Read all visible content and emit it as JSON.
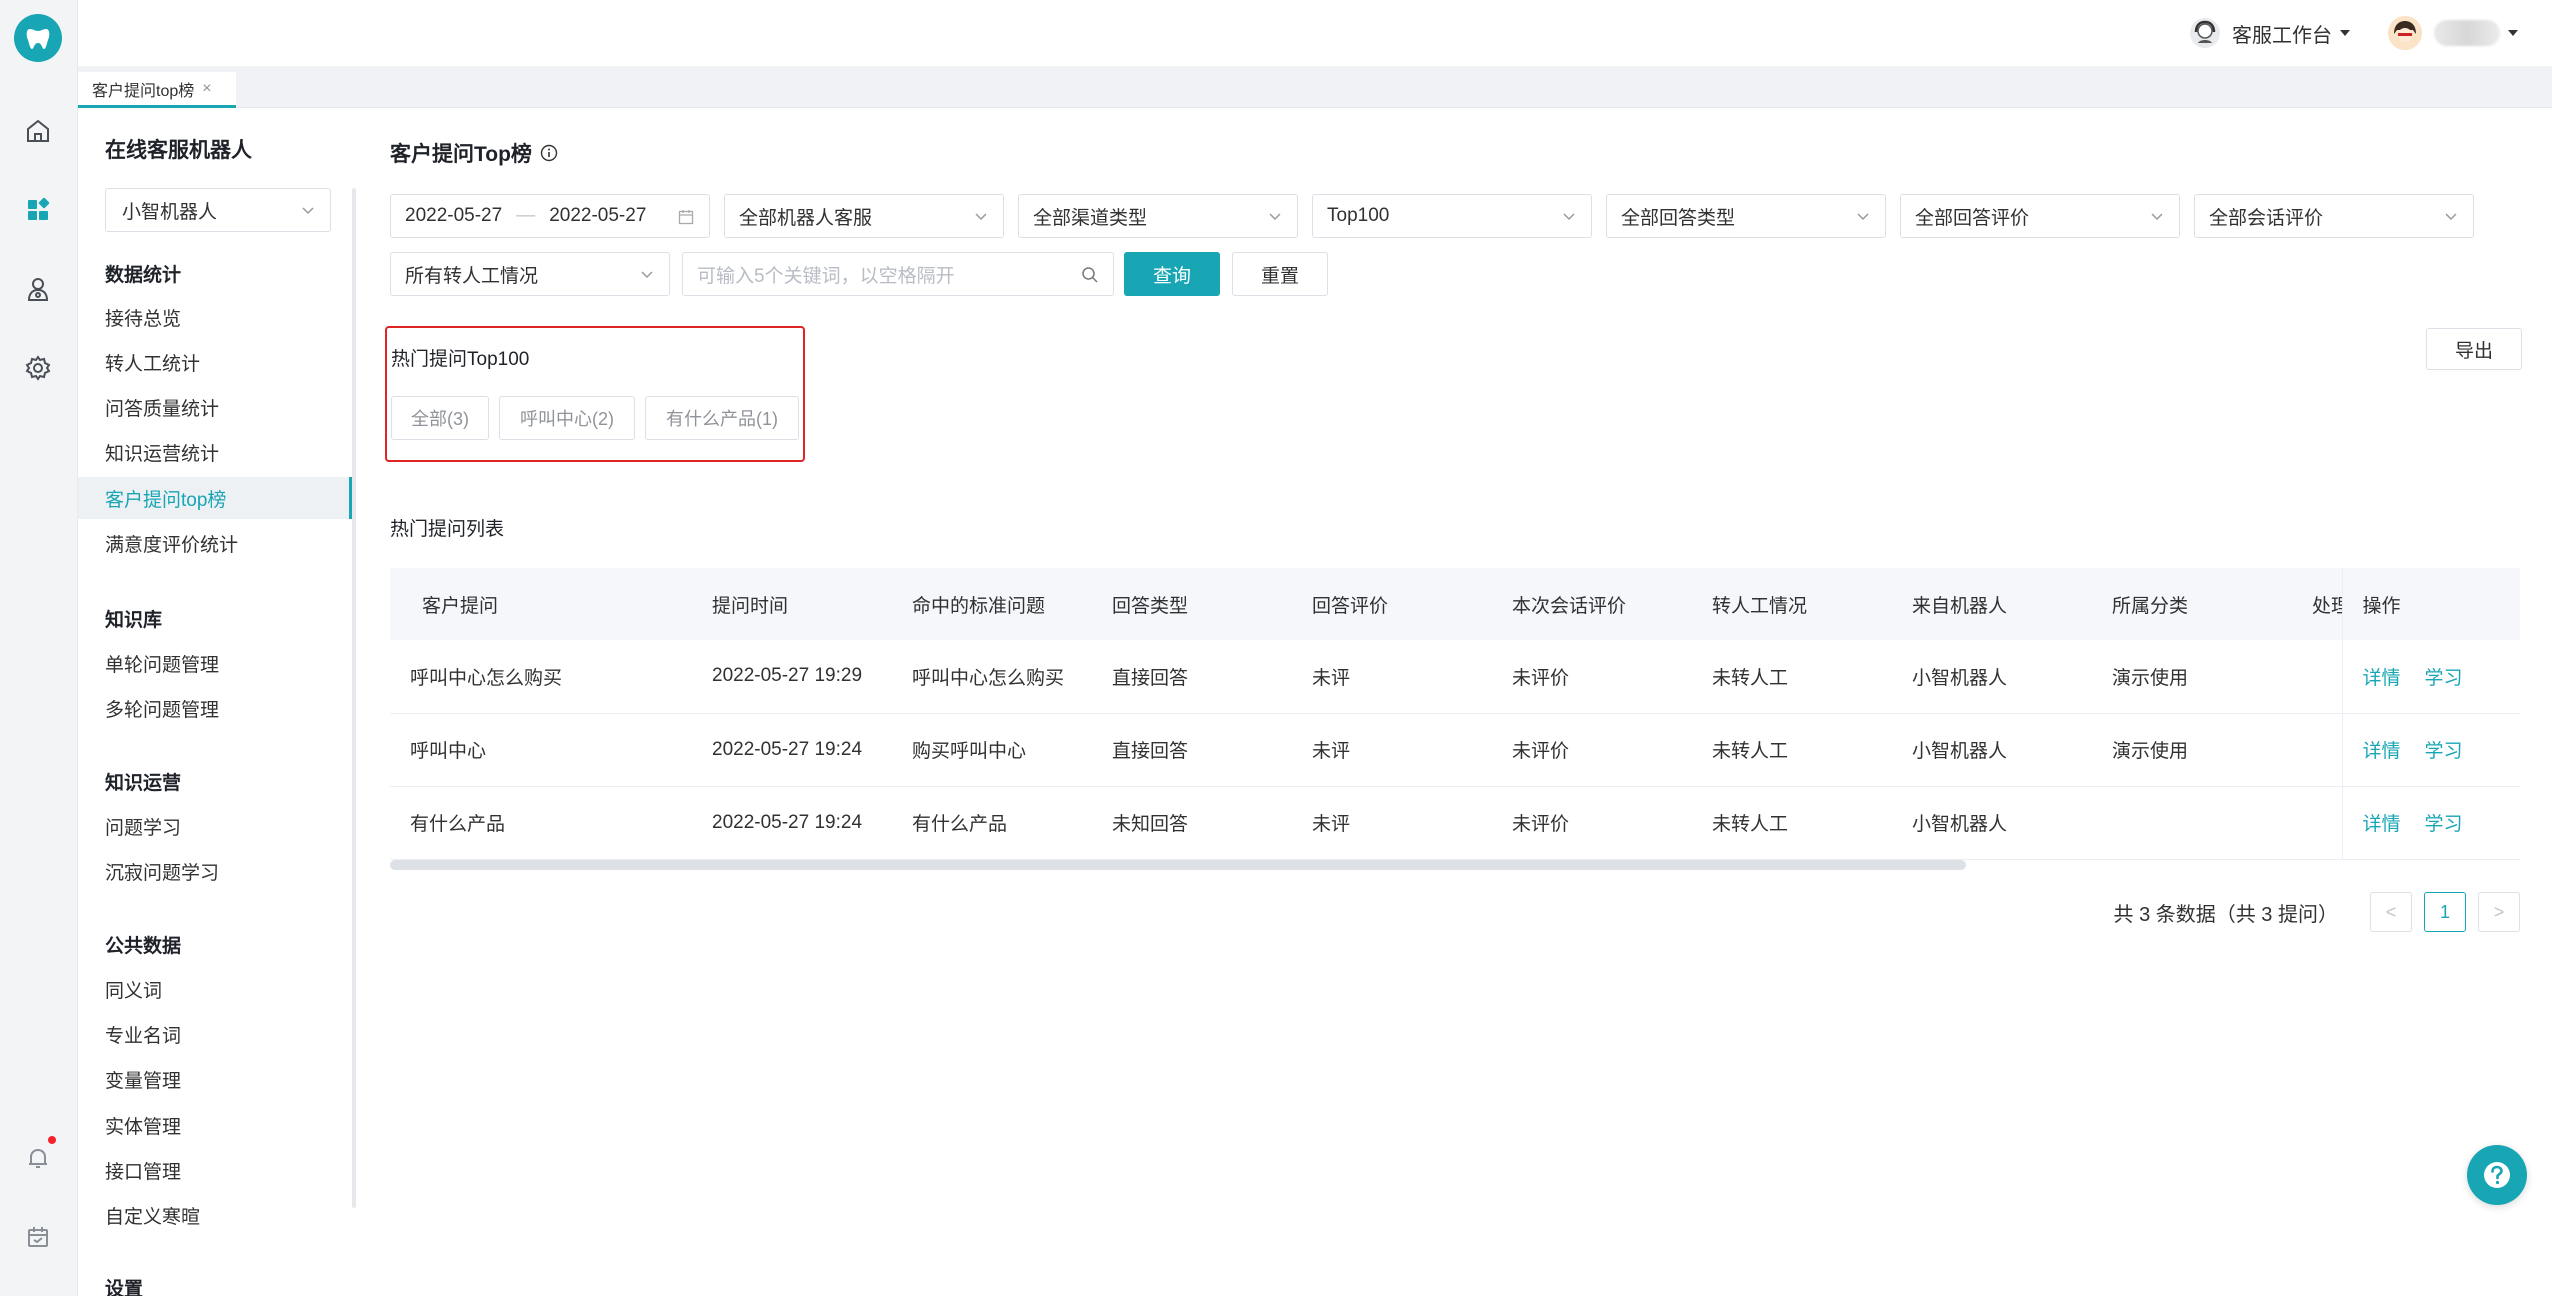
{
  "header": {
    "workbench_label": "客服工作台",
    "accent_color": "#18a5b4"
  },
  "tabs": [
    {
      "label": "客户提问top榜",
      "close": "×"
    }
  ],
  "sidebar": {
    "title": "在线客服机器人",
    "robot_select": "小智机器人",
    "groups": [
      {
        "label": "数据统计",
        "items": [
          "接待总览",
          "转人工统计",
          "问答质量统计",
          "知识运营统计",
          "客户提问top榜",
          "满意度评价统计"
        ]
      },
      {
        "label": "知识库",
        "items": [
          "单轮问题管理",
          "多轮问题管理"
        ]
      },
      {
        "label": "知识运营",
        "items": [
          "问题学习",
          "沉寂问题学习"
        ]
      },
      {
        "label": "公共数据",
        "items": [
          "同义词",
          "专业名词",
          "变量管理",
          "实体管理",
          "接口管理",
          "自定义寒暄"
        ]
      },
      {
        "label": "设置",
        "items": []
      }
    ],
    "active_item": "客户提问top榜"
  },
  "page": {
    "title": "客户提问Top榜",
    "filters": {
      "date_start": "2022-05-27",
      "date_sep": "—",
      "date_end": "2022-05-27",
      "robot": "全部机器人客服",
      "channel": "全部渠道类型",
      "top": "Top100",
      "answer_type": "全部回答类型",
      "answer_rating": "全部回答评价",
      "session_rating": "全部会话评价",
      "transfer": "所有转人工情况",
      "keyword_placeholder": "可输入5个关键词，以空格隔开",
      "query_button": "查询",
      "reset_button": "重置"
    },
    "export_button": "导出",
    "hot": {
      "title": "热门提问Top100",
      "chips": [
        "全部(3)",
        "呼叫中心(2)",
        "有什么产品(1)"
      ]
    },
    "list_title": "热门提问列表",
    "table": {
      "columns": [
        "客户提问",
        "提问时间",
        "命中的标准问题",
        "回答类型",
        "回答评价",
        "本次会话评价",
        "转人工情况",
        "来自机器人",
        "所属分类",
        "处理",
        "操作"
      ],
      "rows": [
        [
          "呼叫中心怎么购买",
          "2022-05-27 19:29",
          "呼叫中心怎么购买",
          "直接回答",
          "未评",
          "未评价",
          "未转人工",
          "小智机器人",
          "演示使用",
          ""
        ],
        [
          "呼叫中心",
          "2022-05-27 19:24",
          "购买呼叫中心",
          "直接回答",
          "未评",
          "未评价",
          "未转人工",
          "小智机器人",
          "演示使用",
          ""
        ],
        [
          "有什么产品",
          "2022-05-27 19:24",
          "有什么产品",
          "未知回答",
          "未评",
          "未评价",
          "未转人工",
          "小智机器人",
          "",
          ""
        ]
      ],
      "actions": [
        "详情",
        "学习"
      ]
    },
    "pagination": {
      "total_text": "共 3 条数据（共 3 提问）",
      "prev": "<",
      "current": "1",
      "next": ">"
    }
  }
}
